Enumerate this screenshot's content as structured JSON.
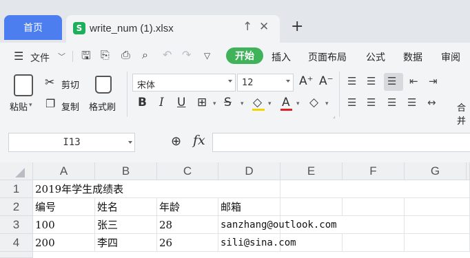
{
  "tabs": {
    "home_label": "首页",
    "file_icon_letter": "S",
    "file_title": "write_num (1).xlsx",
    "new_tab": "+"
  },
  "menu": {
    "file_label": "文件",
    "start_label": "开始",
    "tabs": [
      "插入",
      "页面布局",
      "公式",
      "数据",
      "审阅"
    ]
  },
  "ribbon": {
    "paste_label": "粘贴",
    "cut_label": "剪切",
    "copy_label": "复制",
    "format_painter_label": "格式刷",
    "font_name": "宋体",
    "font_size": "12",
    "merge_partial": "合并"
  },
  "formula_bar": {
    "name_box": "I13",
    "fx_label": "fx",
    "formula": ""
  },
  "sheet": {
    "columns": [
      "A",
      "B",
      "C",
      "D",
      "E",
      "F",
      "G"
    ],
    "rows": [
      "1",
      "2",
      "3",
      "4"
    ],
    "title_cell": "2019年学生成绩表",
    "header": [
      "编号",
      "姓名",
      "年龄",
      "邮箱"
    ],
    "data": [
      [
        "100",
        "张三",
        "28",
        "sanzhang@outlook.com"
      ],
      [
        "200",
        "李四",
        "26",
        "sili@sina.com"
      ]
    ]
  },
  "colors": {
    "accent_blue": "#4c7ef0",
    "start_green": "#3fb25a",
    "sheet_icon_green": "#1fae5b"
  }
}
